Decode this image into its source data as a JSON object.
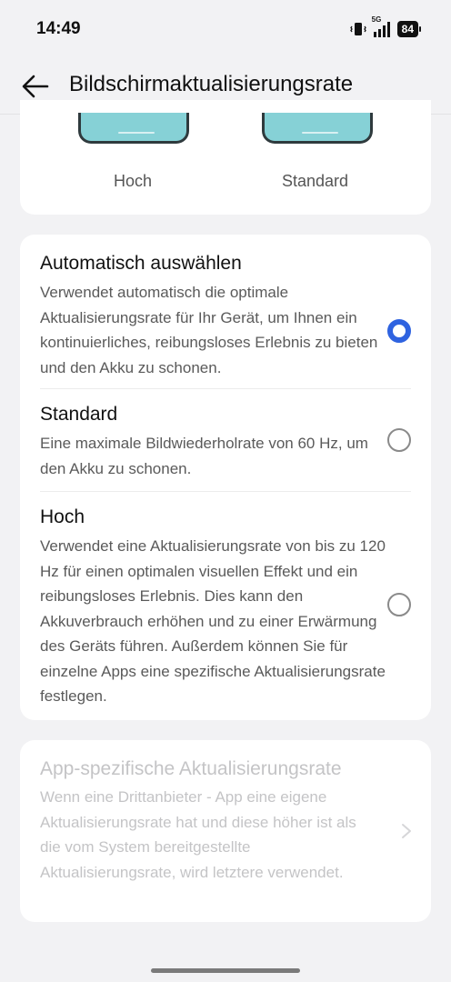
{
  "status_bar": {
    "time": "14:49",
    "network": "5G",
    "battery": "84"
  },
  "header": {
    "title": "Bildschirmaktualisierungsrate"
  },
  "preview": {
    "high_label": "Hoch",
    "standard_label": "Standard",
    "screen_color": "#86d1d6"
  },
  "options": [
    {
      "title": "Automatisch auswählen",
      "description": "Verwendet automatisch die optimale Aktualisierungsrate für Ihr Gerät, um Ihnen ein kontinuierliches, reibungsloses Erlebnis zu bieten und den Akku zu schonen.",
      "selected": true
    },
    {
      "title": "Standard",
      "description": "Eine maximale Bildwiederholrate von 60 Hz, um den Akku zu schonen.",
      "selected": false
    },
    {
      "title": "Hoch",
      "description": "Verwendet eine Aktualisierungsrate von bis zu 120 Hz für einen optimalen visuellen Effekt und ein reibungsloses Erlebnis. Dies kann den Akkuverbrauch erhöhen und zu einer Erwärmung des Geräts führen. Außerdem können Sie für einzelne Apps eine spezifische Aktualisierungsrate festlegen.",
      "selected": false
    }
  ],
  "app_specific": {
    "title": "App-spezifische Aktualisierungsrate",
    "description": "Wenn eine Drittanbieter - App eine eigene Aktualisierungsrate hat und diese höher ist als die vom System bereitgestellte Aktualisierungsrate, wird letztere verwendet.",
    "enabled": false
  },
  "colors": {
    "accent": "#2f63e0",
    "background": "#f2f2f4",
    "disabled_text": "#c4c4c6"
  }
}
